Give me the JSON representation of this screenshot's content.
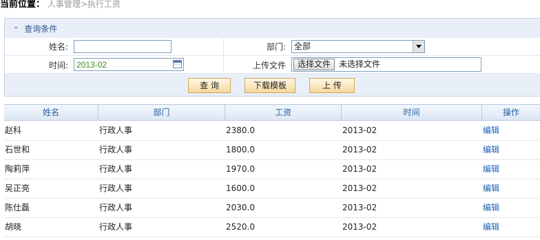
{
  "breadcrumb": {
    "label": "当前位置：",
    "path": "人事管理>执行工资"
  },
  "query": {
    "title": "查询条件",
    "name_label": "姓名:",
    "name_value": "",
    "dept_label": "部门:",
    "dept_value": "全部",
    "time_label": "时间:",
    "time_value": "2013-02",
    "upload_label": "上传文件",
    "choose_file": "选择文件",
    "no_file": "未选择文件",
    "btn_query": "查 询",
    "btn_download": "下载模板",
    "btn_upload": "上 传"
  },
  "table": {
    "columns": [
      "姓名",
      "部门",
      "工资",
      "时间",
      "操作"
    ],
    "rows": [
      {
        "name": "赵科",
        "dept": "行政人事",
        "salary": "2380.0",
        "time": "2013-02",
        "action": "编辑"
      },
      {
        "name": "石世和",
        "dept": "行政人事",
        "salary": "1800.0",
        "time": "2013-02",
        "action": "编辑"
      },
      {
        "name": "陶莉萍",
        "dept": "行政人事",
        "salary": "1970.0",
        "time": "2013-02",
        "action": "编辑"
      },
      {
        "name": "吴正亮",
        "dept": "行政人事",
        "salary": "1600.0",
        "time": "2013-02",
        "action": "编辑"
      },
      {
        "name": "陈仕磊",
        "dept": "行政人事",
        "salary": "2030.0",
        "time": "2013-02",
        "action": "编辑"
      },
      {
        "name": "胡晓",
        "dept": "行政人事",
        "salary": "2520.0",
        "time": "2013-02",
        "action": "编辑"
      }
    ]
  }
}
